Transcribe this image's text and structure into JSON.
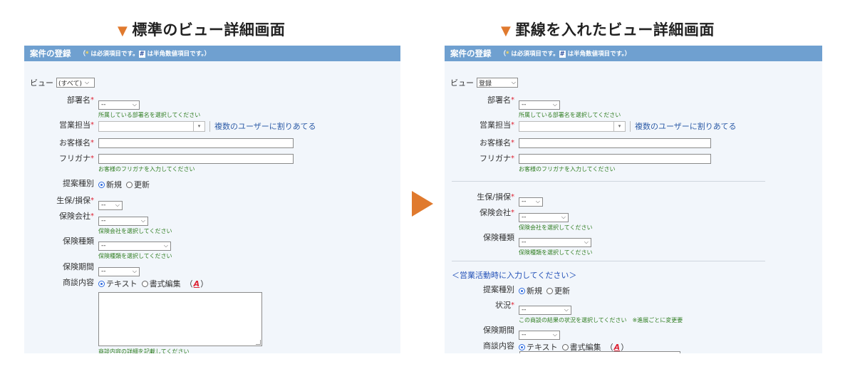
{
  "headings": {
    "left": "標準のビュー詳細画面",
    "right": "罫線を入れたビュー詳細画面"
  },
  "colors": {
    "accent": "#e07a2e",
    "header_bg": "#6fa0d0",
    "required": "#dd2233",
    "hint": "#2f7d20",
    "link": "#2f5da8"
  },
  "panel": {
    "title": "案件の登録",
    "note_open": "（",
    "note_req_mark": "*",
    "note_req_text": " は必須項目です。",
    "note_num_mark": "#",
    "note_num_text": " は半角数値項目です。）"
  },
  "left": {
    "view_label": "ビュー",
    "view_value": "(すべて)",
    "fields": {
      "dept": {
        "label": "部署名",
        "value": "--",
        "hint": "所属している部署名を選択してください"
      },
      "sales": {
        "label": "営業担当",
        "link": "複数のユーザーに割りあてる"
      },
      "customer": {
        "label": "お客様名"
      },
      "kana": {
        "label": "フリガナ",
        "hint": "お客様のフリガナを入力してください"
      },
      "proposal": {
        "label": "提案種別",
        "opt1": "新規",
        "opt2": "更新"
      },
      "life": {
        "label": "生保/損保",
        "value": "--"
      },
      "insurer": {
        "label": "保険会社",
        "value": "--",
        "hint": "保険会社を選択してください"
      },
      "insurance_type": {
        "label": "保険種類",
        "value": "--",
        "hint": "保険種類を選択してください"
      },
      "period": {
        "label": "保険期間",
        "value": "--"
      },
      "content": {
        "label": "商談内容",
        "opt1": "テキスト",
        "opt2": "書式編集",
        "paren_open": "（",
        "fmt_icon": "A",
        "paren_close": "）",
        "hint": "商談内容の詳細を記載してください"
      }
    }
  },
  "right": {
    "view_label": "ビュー",
    "view_value": "登録",
    "section_title": "＜営業活動時に入力してください＞",
    "fields": {
      "dept": {
        "label": "部署名",
        "value": "--",
        "hint": "所属している部署名を選択してください"
      },
      "sales": {
        "label": "営業担当",
        "link": "複数のユーザーに割りあてる"
      },
      "customer": {
        "label": "お客様名"
      },
      "kana": {
        "label": "フリガナ",
        "hint": "お客様のフリガナを入力してください"
      },
      "life": {
        "label": "生保/損保",
        "value": "--"
      },
      "insurer": {
        "label": "保険会社",
        "value": "--",
        "hint": "保険会社を選択してください"
      },
      "insurance_type": {
        "label": "保険種類",
        "value": "--",
        "hint": "保険種類を選択してください"
      },
      "proposal": {
        "label": "提案種別",
        "opt1": "新規",
        "opt2": "更新"
      },
      "status": {
        "label": "状況",
        "value": "--",
        "hint": "この商談の結果の状況を選択してください",
        "hint_note": "※進展ごとに変更要"
      },
      "period": {
        "label": "保険期間",
        "value": "--"
      },
      "content": {
        "label": "商談内容",
        "opt1": "テキスト",
        "opt2": "書式編集",
        "paren_open": "（",
        "fmt_icon": "A",
        "paren_close": "）"
      }
    }
  }
}
